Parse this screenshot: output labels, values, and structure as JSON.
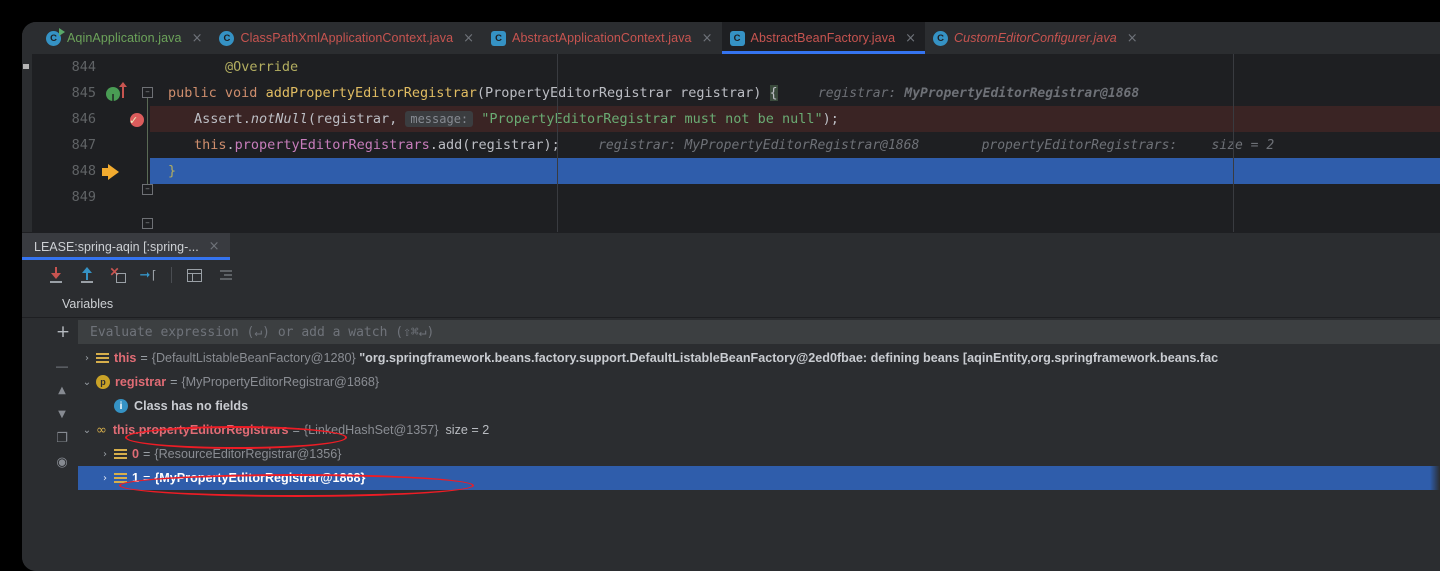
{
  "editor_tabs": [
    {
      "label": "AqinApplication.java",
      "icon": "java-class-run-icon",
      "style": "green",
      "active": false,
      "italic": false
    },
    {
      "label": "ClassPathXmlApplicationContext.java",
      "icon": "java-class-icon",
      "style": "red",
      "active": false,
      "italic": false
    },
    {
      "label": "AbstractApplicationContext.java",
      "icon": "java-abstract-class-icon",
      "style": "red",
      "active": false,
      "italic": false
    },
    {
      "label": "AbstractBeanFactory.java",
      "icon": "java-abstract-class-icon",
      "style": "red",
      "active": true,
      "italic": false
    },
    {
      "label": "CustomEditorConfigurer.java",
      "icon": "java-class-icon",
      "style": "red",
      "active": false,
      "italic": true
    }
  ],
  "close_glyph": "×",
  "code": {
    "lines": [
      {
        "num": "844",
        "gutter": "none"
      },
      {
        "num": "845",
        "gutter": "override-marker"
      },
      {
        "num": "846",
        "gutter": "breakpoint"
      },
      {
        "num": "847",
        "gutter": "none"
      },
      {
        "num": "848",
        "gutter": "execution-pointer"
      },
      {
        "num": "849",
        "gutter": "none"
      }
    ],
    "l844": {
      "annotation": "@Override"
    },
    "l845": {
      "kw1": "public",
      "kw2": "void",
      "method": "addPropertyEditorRegistrar",
      "sig": "(PropertyEditorRegistrar registrar)",
      "brace": "{",
      "hint_label": "registrar:",
      "hint_value": "MyPropertyEditorRegistrar@1868"
    },
    "l846": {
      "pre": "Assert.",
      "call": "notNull",
      "open": "(registrar,",
      "param_hint": "message:",
      "string": "\"PropertyEditorRegistrar must not be null\"",
      "end": ");"
    },
    "l847": {
      "this": "this",
      "dot": ".",
      "field": "propertyEditorRegistrars",
      "call": ".add(registrar);",
      "hint1_label": "registrar:",
      "hint1_value": "MyPropertyEditorRegistrar@1868",
      "hint2_label": "propertyEditorRegistrars:",
      "hint2_value": "size = 2"
    },
    "l848": {
      "text": "}"
    }
  },
  "debugger": {
    "session_tab": "LEASE:spring-aqin [:spring-...",
    "toolbar": [
      {
        "name": "step-into-button",
        "title": "Step Into"
      },
      {
        "name": "step-out-button",
        "title": "Step Out"
      },
      {
        "name": "force-step-into-button",
        "title": "Force Step Into"
      },
      {
        "name": "run-to-cursor-button",
        "title": "Run to Cursor"
      },
      {
        "name": "evaluate-expression-button",
        "title": "Evaluate Expression"
      },
      {
        "name": "settings-lines-button",
        "title": "Layout Settings"
      }
    ],
    "variables_tab": "Variables",
    "evaluate_placeholder": "Evaluate expression (↵) or add a watch (⇧⌘↵)",
    "add_watch_glyph": "+",
    "side_toolbar": [
      {
        "name": "remove-watch-button",
        "glyph": "—"
      },
      {
        "name": "move-up-button",
        "glyph": "▲"
      },
      {
        "name": "move-down-button",
        "glyph": "▼"
      },
      {
        "name": "copy-value-button",
        "glyph": "❐"
      },
      {
        "name": "show-hide-button",
        "glyph": "◉"
      }
    ],
    "tree": [
      {
        "id": "this",
        "chev": "›",
        "expanded": false,
        "icon": "object-list-icon",
        "indent": 0,
        "name": "this",
        "type": "{DefaultListableBeanFactory@1280}",
        "value": "\"org.springframework.beans.factory.support.DefaultListableBeanFactory@2ed0fbae: defining beans [aqinEntity,org.springframework.beans.fac",
        "selected": false,
        "circled": false
      },
      {
        "id": "registrar",
        "chev": "⌄",
        "expanded": true,
        "icon": "parameter-icon",
        "indent": 0,
        "name": "registrar",
        "type": "{MyPropertyEditorRegistrar@1868}",
        "value": "",
        "selected": false,
        "circled": false
      },
      {
        "id": "class-has-no-fields",
        "chev": "",
        "expanded": false,
        "icon": "info-icon",
        "indent": 1,
        "name": "",
        "type": "",
        "message": "Class has no fields",
        "value": "",
        "selected": false,
        "circled": false
      },
      {
        "id": "watch-propertyEditorRegistrars",
        "chev": "⌄",
        "expanded": true,
        "icon": "watch-icon",
        "indent": 0,
        "name": "this.propertyEditorRegistrars",
        "type": "{LinkedHashSet@1357}",
        "size": "size = 2",
        "value": "",
        "selected": false,
        "circled": true
      },
      {
        "id": "element-0",
        "chev": "›",
        "expanded": false,
        "icon": "object-list-icon",
        "indent": 1,
        "name": "0",
        "type": "{ResourceEditorRegistrar@1356}",
        "value": "",
        "selected": false,
        "circled": false
      },
      {
        "id": "element-1",
        "chev": "›",
        "expanded": false,
        "icon": "object-list-icon",
        "indent": 1,
        "name": "1",
        "type": "{MyPropertyEditorRegistrar@1868}",
        "value": "",
        "selected": true,
        "circled": true
      }
    ]
  },
  "gutter_line_numbers": [
    "844",
    "845",
    "846",
    "847",
    "848",
    "849"
  ],
  "colors": {
    "accent": "#3574f0",
    "selection": "#2f5dab",
    "annotation_red": "#ee1c25",
    "editor_bg": "#1e1f22",
    "panel_bg": "#2b2d30",
    "breakpoint": "#db5c5c",
    "exec_pointer": "#f2ab2f"
  }
}
